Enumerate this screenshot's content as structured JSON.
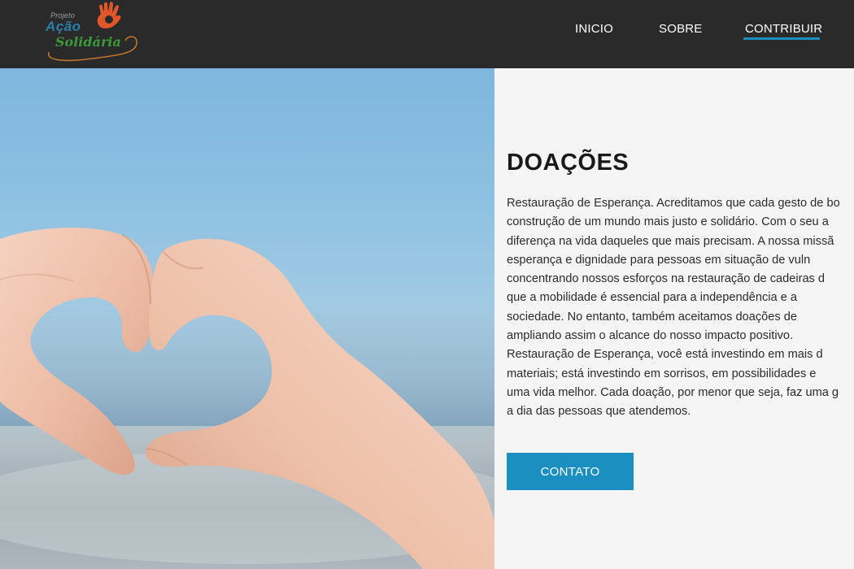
{
  "header": {
    "logo": {
      "line1": "Projeto",
      "line2": "Ação",
      "line3": "Solidária"
    },
    "nav": [
      {
        "label": "INICIO"
      },
      {
        "label": "SOBRE"
      },
      {
        "label": "CONTRIBUIR",
        "active": true
      }
    ]
  },
  "main": {
    "title": "DOAÇÕES",
    "body_lines": [
      "Restauração de Esperança. Acreditamos que cada gesto de bo",
      "construção de um mundo mais justo e solidário. Com o seu a",
      "diferença na vida daqueles que mais precisam. A nossa missã",
      "esperança e dignidade para pessoas em situação de vuln",
      "concentrando nossos esforços na restauração de cadeiras d",
      "que a mobilidade é essencial para a independência e a",
      "sociedade. No entanto, também aceitamos doações de",
      "ampliando assim o alcance do nosso impacto positivo.",
      "Restauração de Esperança, você está investindo em mais d",
      "materiais; está investindo em sorrisos, em possibilidades e",
      "uma vida melhor. Cada doação, por menor que seja, faz uma g",
      "a dia das pessoas que atendemos."
    ],
    "contact_button": "CONTATO"
  },
  "colors": {
    "header_bg": "#2a2a2a",
    "accent": "#1a8fc0",
    "content_bg": "#f5f5f5"
  }
}
